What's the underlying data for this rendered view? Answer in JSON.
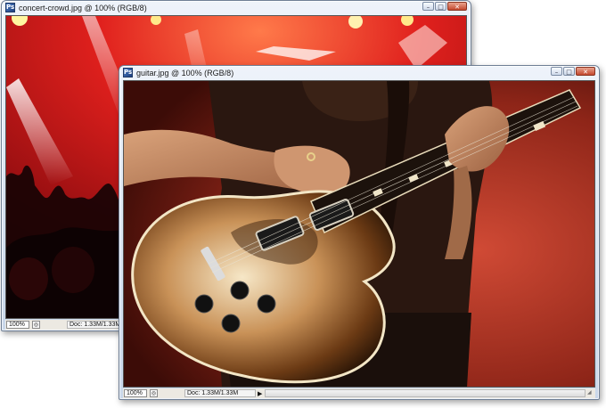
{
  "windows": [
    {
      "title": "concert-crowd.jpg @ 100% (RGB/8)",
      "status": {
        "zoom": "100%",
        "doc_info": "Doc: 1.33M/1.33M"
      }
    },
    {
      "title": "guitar.jpg @ 100% (RGB/8)",
      "status": {
        "zoom": "100%",
        "doc_info": "Doc: 1.33M/1.33M"
      }
    }
  ],
  "controls": {
    "minimize": "–",
    "maximize": "□",
    "close": "✕"
  },
  "icons": {
    "document": "photoshop-document-icon",
    "navigator": "navigator-icon",
    "status_arrow": "play-arrow-icon",
    "resize": "resize-grip-icon"
  },
  "colors": {
    "title_gradient_top": "#eef3fa",
    "title_gradient_bottom": "#c9d7ea",
    "close_button": "#c4482e",
    "stage_red": "#c0141a",
    "stage_light": "#ffe98a",
    "guitar_cream": "#f3e6c6",
    "guitar_sunburst_dark": "#2a1506"
  }
}
